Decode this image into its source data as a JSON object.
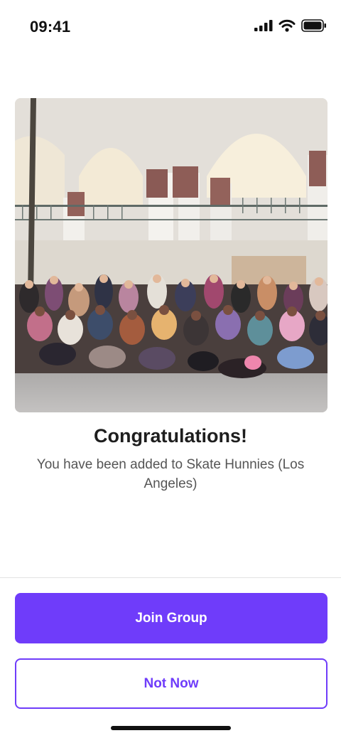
{
  "status_bar": {
    "time": "09:41"
  },
  "hero_image": {
    "alt": "Group photo of roller skaters"
  },
  "content": {
    "title": "Congratulations!",
    "message": "You have been added to Skate Hunnies (Los Angeles)"
  },
  "actions": {
    "primary_label": "Join Group",
    "secondary_label": "Not Now"
  },
  "colors": {
    "accent": "#6f3cfa",
    "title": "#1e1e1e",
    "body_text": "#555555"
  },
  "icons": [
    "signal-icon",
    "wifi-icon",
    "battery-icon"
  ]
}
